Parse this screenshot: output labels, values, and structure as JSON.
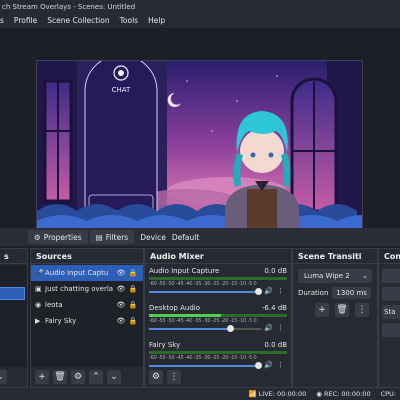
{
  "window": {
    "title": "ch Stream Overlays - Scenes: Untitled"
  },
  "menu": [
    "s",
    "Profile",
    "Scene Collection",
    "Tools",
    "Help"
  ],
  "preview": {
    "chat_label": "CHAT"
  },
  "context_bar": {
    "properties_label": "Properties",
    "filters_label": "Filters",
    "device_label": "Device",
    "device_value": "Default"
  },
  "sources": {
    "title": "Sources",
    "items": [
      {
        "name": "Audio Input Captu",
        "icon": "mic-icon",
        "selected": true
      },
      {
        "name": "Just chatting overla",
        "icon": "image-icon",
        "selected": false
      },
      {
        "name": "leota",
        "icon": "camera-icon",
        "selected": false
      },
      {
        "name": "Fairy Sky",
        "icon": "play-icon",
        "selected": false
      }
    ]
  },
  "mixer": {
    "title": "Audio Mixer",
    "scale": "-60 -55 -50 -45 -40 -35 -30 -25 -20 -15 -10 -5 0",
    "channels": [
      {
        "name": "Audio Input Capture",
        "db": "0.0 dB",
        "level": 0.0,
        "fader": 0.97
      },
      {
        "name": "Desktop Audio",
        "db": "-6.4 dB",
        "level": 0.52,
        "fader": 0.72
      },
      {
        "name": "Fairy Sky",
        "db": "0.0 dB",
        "level": 0.0,
        "fader": 0.97
      }
    ]
  },
  "transitions": {
    "title": "Scene Transiti",
    "selected": "Luma Wipe 2",
    "duration_label": "Duration",
    "duration_value": "1300 ms"
  },
  "controls": {
    "title": "Cont",
    "start_label": "Sta"
  },
  "status": {
    "live": "LIVE: 00:00:00",
    "rec": "REC: 00:00:00",
    "cpu": "CPU:"
  }
}
